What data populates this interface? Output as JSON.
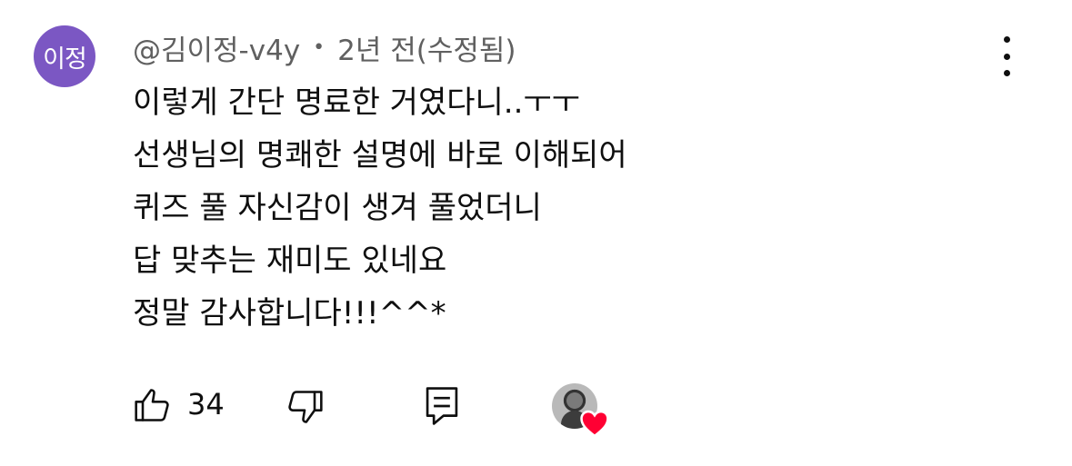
{
  "comment": {
    "avatar_text": "이정",
    "author": "@김이정-v4y",
    "separator": "•",
    "time": "2년 전",
    "edited": "(수정됨)",
    "lines": [
      "이렇게 간단 명료한 거였다니..ㅜㅜ",
      "선생님의 명쾌한 설명에 바로 이해되어",
      "퀴즈 풀 자신감이 생겨 풀었더니",
      "답 맞추는 재미도 있네요",
      "정말 감사합니다!!!^^*"
    ],
    "like_count": "34"
  },
  "icons": {
    "more": "more-vertical-icon",
    "like": "thumbs-up-icon",
    "dislike": "thumbs-down-icon",
    "reply": "reply-comment-icon",
    "heart": "heart-icon"
  },
  "colors": {
    "avatar_bg": "#7b57c3",
    "meta_text": "#606060",
    "heart": "#ff0033"
  }
}
